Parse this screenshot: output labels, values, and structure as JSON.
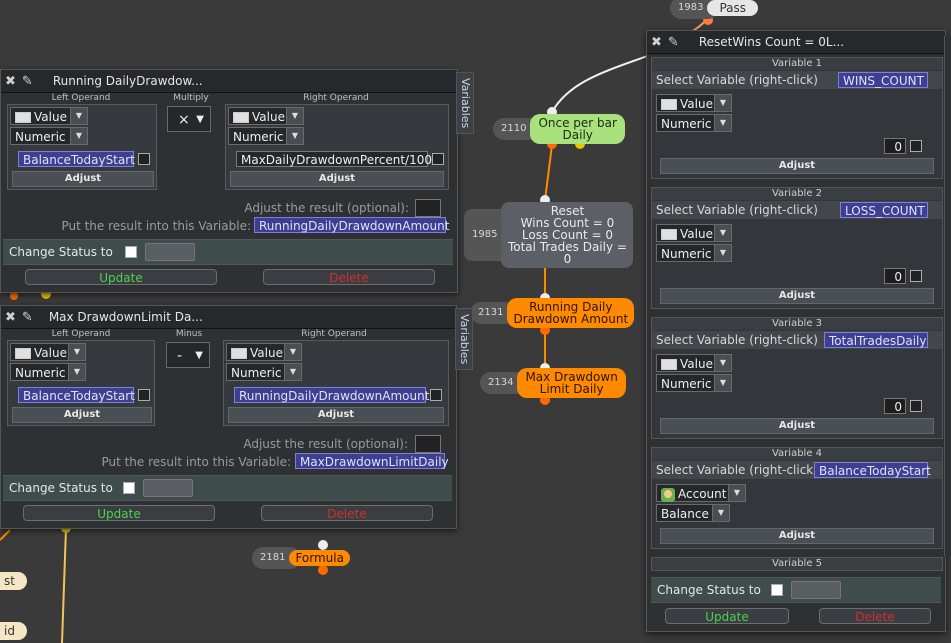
{
  "nodes": {
    "pass": {
      "id": "1983",
      "label": "Pass"
    },
    "once_per_bar": {
      "id": "2110",
      "label_line1": "Once per bar",
      "label_line2": "Daily"
    },
    "reset": {
      "id": "1985",
      "line1": "Reset",
      "line2": "Wins Count = 0",
      "line3": "Loss Count = 0",
      "line4": "Total Trades Daily = 0"
    },
    "running_daily_drawdown": {
      "id": "2131",
      "label_line1": "Running Daily",
      "label_line2": "Drawdown Amount"
    },
    "max_drawdown_limit": {
      "id": "2134",
      "label_line1": "Max Drawdown",
      "label_line2": "Limit Daily"
    },
    "formula": {
      "id": "2181",
      "label": "Formula"
    },
    "stub1": "st",
    "stub2": "id"
  },
  "panel1": {
    "title": "Running DailyDrawdow...",
    "vars_tab": "Variables",
    "left_head": "Left Operand",
    "op_head": "Multiply",
    "right_head": "Right Operand",
    "operator": "×",
    "left": {
      "type": "Value",
      "kind": "Numeric",
      "var": "BalanceTodayStart",
      "adjust": "Adjust"
    },
    "right": {
      "type": "Value",
      "kind": "Numeric",
      "var": "MaxDailyDrawdownPercent/100",
      "adjust": "Adjust"
    },
    "adjust_label": "Adjust the result (optional):",
    "result_label": "Put the result into this Variable:",
    "result_var": "RunningDailyDrawdownAmount",
    "status_label": "Change Status to",
    "update": "Update",
    "delete": "Delete"
  },
  "panel2": {
    "title": "Max DrawdownLimit Da...",
    "vars_tab": "Variables",
    "left_head": "Left Operand",
    "op_head": "Minus",
    "right_head": "Right Operand",
    "operator": "-",
    "left": {
      "type": "Value",
      "kind": "Numeric",
      "var": "BalanceTodayStart",
      "adjust": "Adjust"
    },
    "right": {
      "type": "Value",
      "kind": "Numeric",
      "var": "RunningDailyDrawdownAmount",
      "adjust": "Adjust"
    },
    "adjust_label": "Adjust the result (optional):",
    "result_label": "Put the result into this Variable:",
    "result_var": "MaxDrawdownLimitDaily",
    "status_label": "Change Status to",
    "update": "Update",
    "delete": "Delete"
  },
  "panel3": {
    "title": "ResetWins Count = 0L...",
    "select_label": "Select Variable (right-click)",
    "variables": [
      {
        "header": "Variable 1",
        "var": "WINS_COUNT",
        "type": "Value",
        "kind": "Numeric",
        "value": "0",
        "adjust": "Adjust"
      },
      {
        "header": "Variable 2",
        "var": "LOSS_COUNT",
        "type": "Value",
        "kind": "Numeric",
        "value": "0",
        "adjust": "Adjust"
      },
      {
        "header": "Variable 3",
        "var": "TotalTradesDaily",
        "type": "Value",
        "kind": "Numeric",
        "value": "0",
        "adjust": "Adjust"
      },
      {
        "header": "Variable 4",
        "var": "BalanceTodayStart",
        "type": "Account",
        "kind": "Balance",
        "adjust": "Adjust"
      }
    ],
    "var5_header": "Variable 5",
    "status_label": "Change Status to",
    "update": "Update",
    "delete": "Delete"
  }
}
